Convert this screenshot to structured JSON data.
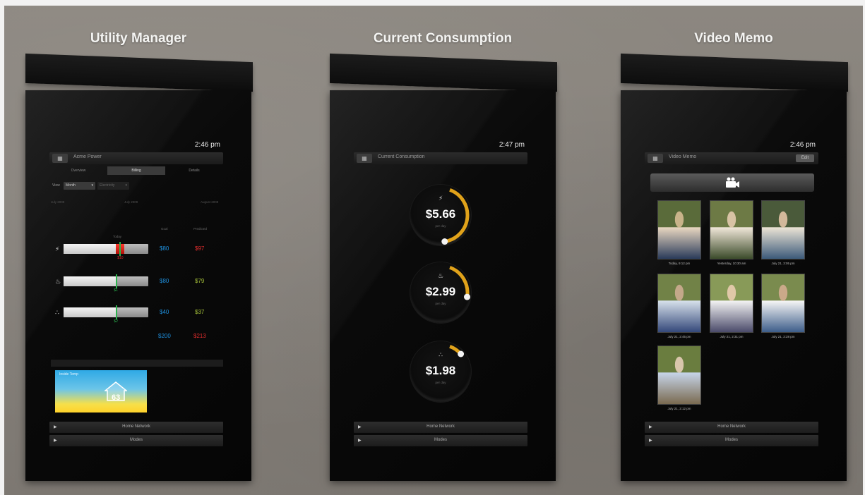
{
  "titles": {
    "utility": "Utility Manager",
    "consumption": "Current Consumption",
    "video": "Video Memo"
  },
  "utility_panel": {
    "time": "2:46 pm",
    "header": "Acme Power",
    "tabs": [
      "Overview",
      "Billing",
      "Details"
    ],
    "view_label": "View",
    "view_select": "Month",
    "utility_select": "Electricity",
    "dates": [
      "July 2009",
      "July 2009",
      "August 2009"
    ],
    "columns": {
      "today": "Today",
      "goal": "Goal",
      "predicted": "Predicted"
    },
    "rows": [
      {
        "icon": "lightning-icon",
        "fill": 0.62,
        "over": 0.1,
        "marker": 0.66,
        "amount": "$10",
        "goal": "$80",
        "predicted": "$97",
        "pred_color": "#e22d2d"
      },
      {
        "icon": "flame-icon",
        "fill": 0.62,
        "over": 0,
        "marker": 0.62,
        "amount": "$1",
        "goal": "$80",
        "predicted": "$79",
        "pred_color": "#a6c23a"
      },
      {
        "icon": "water-icon",
        "fill": 0.62,
        "over": 0,
        "marker": 0.62,
        "amount": "$2",
        "goal": "$40",
        "predicted": "$37",
        "pred_color": "#a6c23a"
      }
    ],
    "total_goal": "$200",
    "total_predicted": "$213",
    "thermostat_label": "Inside Temp",
    "thermostat_temp": "63",
    "footer": [
      "Home Network",
      "Modes"
    ],
    "colors": {
      "goal": "#1e8fdc",
      "over": "#e22d2d",
      "ok": "#a6c23a"
    }
  },
  "consumption_panel": {
    "time": "2:47 pm",
    "header": "Current Consumption",
    "gauges": [
      {
        "icon": "lightning-icon",
        "value": "$5.66",
        "sub": "per day",
        "fraction": 0.42
      },
      {
        "icon": "flame-icon",
        "value": "$2.99",
        "sub": "per day",
        "fraction": 0.22
      },
      {
        "icon": "water-icon",
        "value": "$1.98",
        "sub": "per day",
        "fraction": 0.08
      }
    ],
    "footer": [
      "Home Network",
      "Modes"
    ]
  },
  "video_panel": {
    "time": "2:46 pm",
    "header": "Video Memo",
    "edit_label": "Edit",
    "record_icon": "video-camera-icon",
    "thumbnails": [
      {
        "caption": "Today, 9:12 pm"
      },
      {
        "caption": "Yesterday, 10:30 am"
      },
      {
        "caption": "July 21, 3:05 pm"
      },
      {
        "caption": "July 21, 2:45 pm"
      },
      {
        "caption": "July 21, 2:31 pm"
      },
      {
        "caption": "July 21, 2:28 pm"
      },
      {
        "caption": "July 21, 2:12 pm"
      }
    ],
    "footer": [
      "Home Network",
      "Modes"
    ]
  }
}
